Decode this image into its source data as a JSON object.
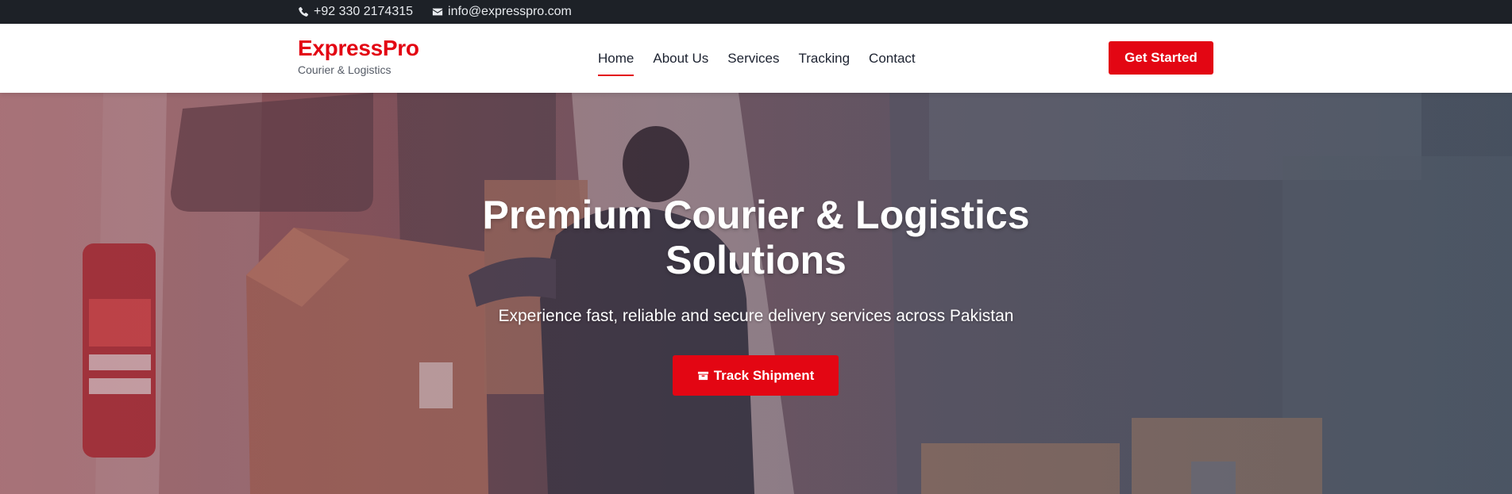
{
  "topbar": {
    "phone": "+92 330 2174315",
    "email": "info@expresspro.com",
    "phone_icon": "phone-icon",
    "email_icon": "envelope-icon"
  },
  "header": {
    "brand_name": "ExpressPro",
    "brand_tagline": "Courier & Logistics",
    "nav": [
      "Home",
      "About Us",
      "Services",
      "Tracking",
      "Contact"
    ],
    "active_nav": "Home",
    "cta_label": "Get Started"
  },
  "hero": {
    "title": "Premium Courier & Logistics Solutions",
    "subtitle": "Experience fast, reliable and secure delivery services across Pakistan",
    "button_label": "Track Shipment",
    "button_icon": "box-icon"
  },
  "colors": {
    "accent": "#e30613",
    "topbar_bg": "#1d2127",
    "text_dark": "#1c2230"
  }
}
